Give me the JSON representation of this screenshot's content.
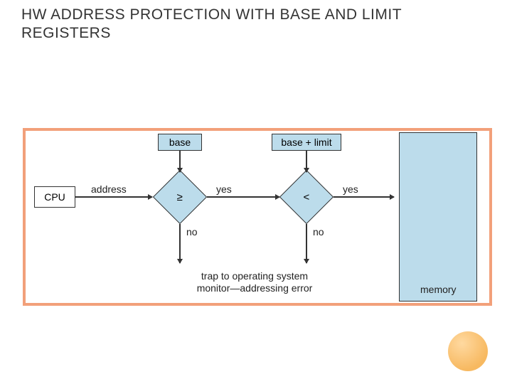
{
  "title": "HW ADDRESS PROTECTION WITH BASE AND LIMIT REGISTERS",
  "diagram": {
    "cpu": "CPU",
    "base": "base",
    "base_plus_limit": "base + limit",
    "memory": "memory",
    "address": "address",
    "cmp1": "≥",
    "cmp2": "<",
    "yes": "yes",
    "no": "no",
    "trap_line1": "trap to operating system",
    "trap_line2": "monitor—addressing error"
  }
}
